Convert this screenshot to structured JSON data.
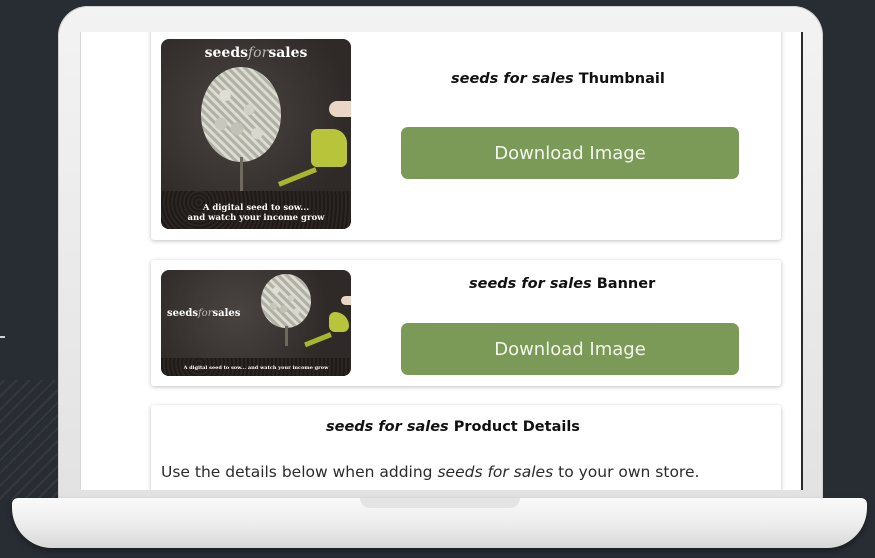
{
  "page": {
    "cards": [
      {
        "id": "thumbnail",
        "title_product": "seeds for sales",
        "title_suffix": "Thumbnail",
        "button_label": "Download Image",
        "image": {
          "brand_main": "seeds",
          "brand_for": "for",
          "brand_end": "sales",
          "tagline_line1": "A digital seed to sow...",
          "tagline_line2": "and watch your income grow"
        }
      },
      {
        "id": "banner",
        "title_product": "seeds for sales",
        "title_suffix": "Banner",
        "button_label": "Download Image",
        "image": {
          "brand_main": "seeds",
          "brand_for": "for",
          "brand_end": "sales",
          "tagline": "A digital seed to sow... and watch your income grow"
        }
      }
    ],
    "details": {
      "title_product": "seeds for sales",
      "title_suffix": "Product Details",
      "text_before": "Use the details below when adding ",
      "text_product": "seeds for sales",
      "text_after": " to your own store."
    }
  },
  "colors": {
    "background": "#282d33",
    "button": "#7c9a57",
    "can": "#b8c43a"
  }
}
